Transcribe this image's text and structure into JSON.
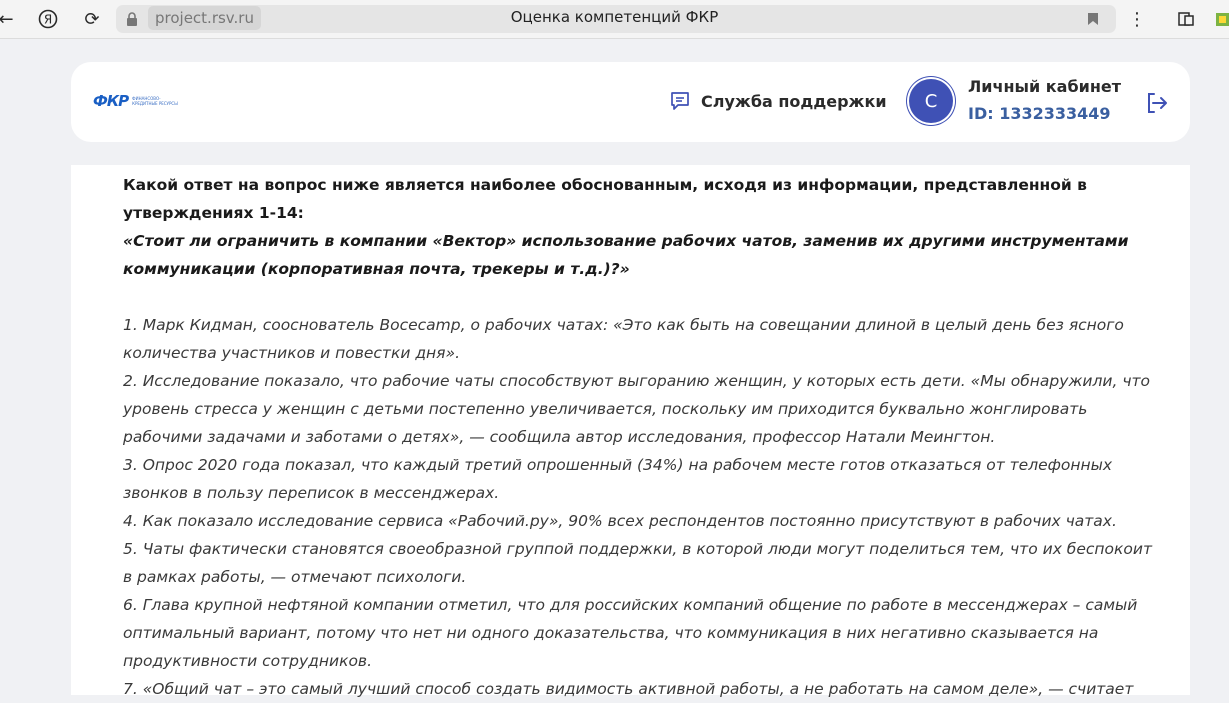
{
  "browser": {
    "url": "project.rsv.ru",
    "tab_title": "Оценка компетенций ФКР"
  },
  "header": {
    "logo_text": "ФКР",
    "logo_sub": "ФИНАНСОВО-КРЕДИТНЫЕ РЕСУРСЫ",
    "support_label": "Служба поддержки",
    "avatar_letter": "С",
    "account_title": "Личный кабинет",
    "account_id": "ID: 1332333449"
  },
  "question": {
    "heading": "Какой ответ на вопрос ниже является наиболее обоснованным, исходя из информации, представленной в утверждениях 1-14:",
    "quote": "«Стоит ли ограничить в компании «Вектор» использование рабочих чатов, заменив их другими инструментами коммуникации (корпоративная почта, трекеры и т.д.)?»"
  },
  "statements": [
    "1.  Марк Кидман, сооснователь Bocecamp, о рабочих чатах: «Это как быть на совещании длиной в целый день без ясного количества участников и повестки дня».",
    "2. Исследование показало, что рабочие чаты способствуют выгоранию женщин, у которых есть дети. «Мы обнаружили, что уровень стресса у женщин с детьми постепенно увеличивается, поскольку им приходится буквально жонглировать рабочими задачами и заботами о детях», — сообщила автор исследования, профессор Натали Меингтон.",
    "3. Опрос 2020 года показал, что каждый третий опрошенный (34%) на рабочем месте готов отказаться от телефонных звонков в пользу переписок в мессенджерах.",
    "4. Как показало исследование сервиса «Рабочий.ру», 90% всех респондентов постоянно присутствуют в рабочих чатах.",
    "5. Чаты фактически становятся своеобразной группой поддержки, в которой люди могут поделиться тем, что их беспокоит в рамках работы, — отмечают психологи.",
    "6. Глава крупной нефтяной компании отметил, что для российских компаний общение по работе в мессенджерах – самый оптимальный вариант, потому что нет ни одного доказательства, что коммуникация в них негативно сказывается на продуктивности сотрудников.",
    "7. «Общий чат – это самый лучший способ создать видимость активной работы, а не работать на самом деле», — считает"
  ],
  "colors": {
    "accent": "#3f51b5",
    "id_color": "#3a5fa0",
    "logo_blue": "#1a5fc4"
  }
}
